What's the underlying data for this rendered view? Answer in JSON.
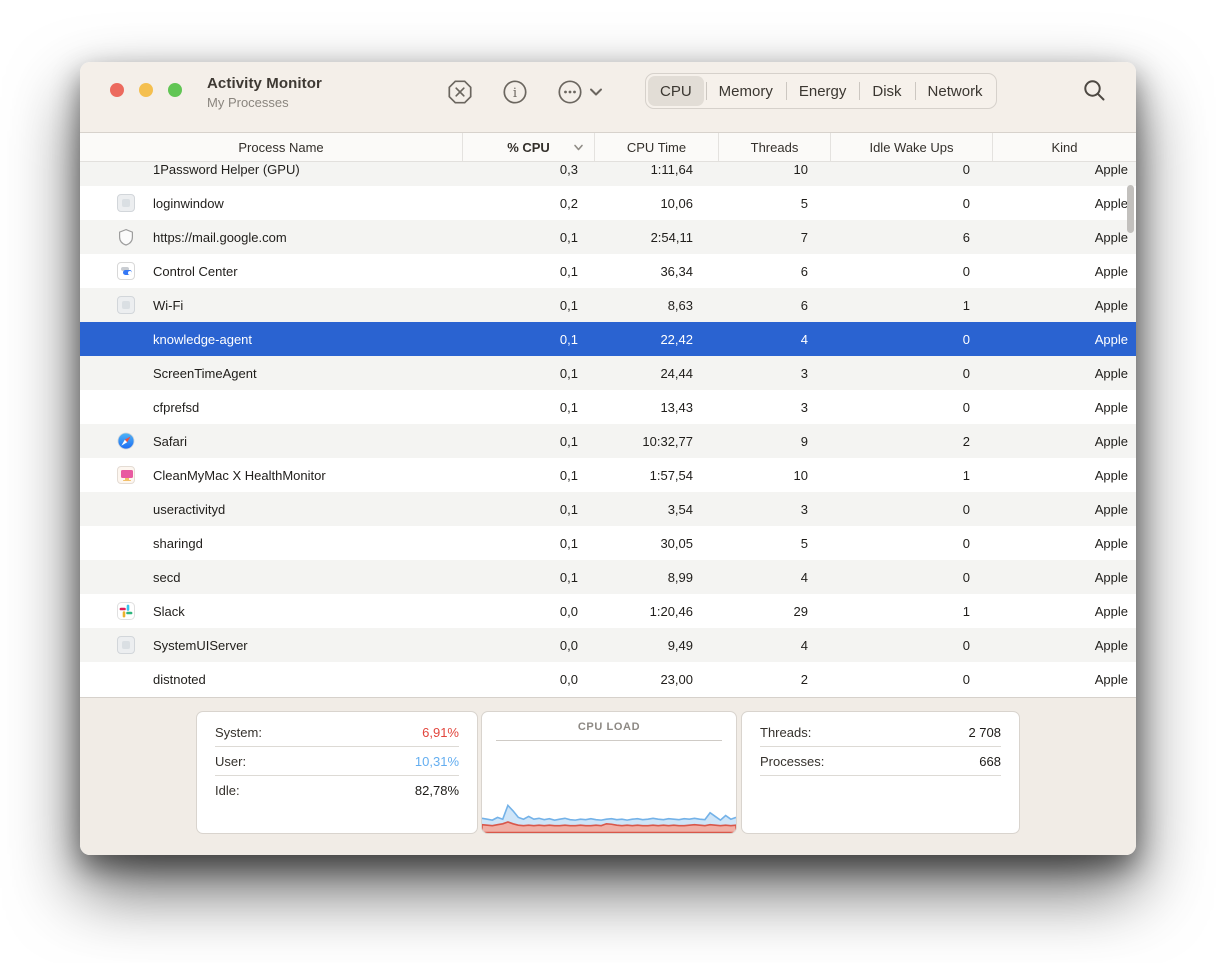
{
  "titlebar": {
    "title": "Activity Monitor",
    "subtitle": "My Processes",
    "segments": [
      {
        "label": "CPU",
        "selected": true
      },
      {
        "label": "Memory",
        "selected": false
      },
      {
        "label": "Energy",
        "selected": false
      },
      {
        "label": "Disk",
        "selected": false
      },
      {
        "label": "Network",
        "selected": false
      }
    ]
  },
  "table": {
    "columns": [
      {
        "label": "Process Name"
      },
      {
        "label": "% CPU",
        "sorted": "desc"
      },
      {
        "label": "CPU Time"
      },
      {
        "label": "Threads"
      },
      {
        "label": "Idle Wake Ups"
      },
      {
        "label": "Kind"
      }
    ],
    "rows": [
      {
        "name": "1Password Helper (GPU)",
        "icon": "none",
        "cpu": "0,3",
        "time": "1:11,64",
        "threads": "10",
        "wakeups": "0",
        "kind": "Apple",
        "clipped": true
      },
      {
        "name": "loginwindow",
        "icon": "generic-app",
        "cpu": "0,2",
        "time": "10,06",
        "threads": "5",
        "wakeups": "0",
        "kind": "Apple"
      },
      {
        "name": "https://mail.google.com",
        "icon": "shield",
        "cpu": "0,1",
        "time": "2:54,11",
        "threads": "7",
        "wakeups": "6",
        "kind": "Apple"
      },
      {
        "name": "Control Center",
        "icon": "control-center",
        "cpu": "0,1",
        "time": "36,34",
        "threads": "6",
        "wakeups": "0",
        "kind": "Apple"
      },
      {
        "name": "Wi-Fi",
        "icon": "generic-app",
        "cpu": "0,1",
        "time": "8,63",
        "threads": "6",
        "wakeups": "1",
        "kind": "Apple"
      },
      {
        "name": "knowledge-agent",
        "icon": "none",
        "cpu": "0,1",
        "time": "22,42",
        "threads": "4",
        "wakeups": "0",
        "kind": "Apple",
        "selected": true
      },
      {
        "name": "ScreenTimeAgent",
        "icon": "none",
        "cpu": "0,1",
        "time": "24,44",
        "threads": "3",
        "wakeups": "0",
        "kind": "Apple"
      },
      {
        "name": "cfprefsd",
        "icon": "none",
        "cpu": "0,1",
        "time": "13,43",
        "threads": "3",
        "wakeups": "0",
        "kind": "Apple"
      },
      {
        "name": "Safari",
        "icon": "safari",
        "cpu": "0,1",
        "time": "10:32,77",
        "threads": "9",
        "wakeups": "2",
        "kind": "Apple"
      },
      {
        "name": "CleanMyMac X HealthMonitor",
        "icon": "cleanmymac",
        "cpu": "0,1",
        "time": "1:57,54",
        "threads": "10",
        "wakeups": "1",
        "kind": "Apple"
      },
      {
        "name": "useractivityd",
        "icon": "none",
        "cpu": "0,1",
        "time": "3,54",
        "threads": "3",
        "wakeups": "0",
        "kind": "Apple"
      },
      {
        "name": "sharingd",
        "icon": "none",
        "cpu": "0,1",
        "time": "30,05",
        "threads": "5",
        "wakeups": "0",
        "kind": "Apple"
      },
      {
        "name": "secd",
        "icon": "none",
        "cpu": "0,1",
        "time": "8,99",
        "threads": "4",
        "wakeups": "0",
        "kind": "Apple"
      },
      {
        "name": "Slack",
        "icon": "slack",
        "cpu": "0,0",
        "time": "1:20,46",
        "threads": "29",
        "wakeups": "1",
        "kind": "Apple"
      },
      {
        "name": "SystemUIServer",
        "icon": "generic-app",
        "cpu": "0,0",
        "time": "9,49",
        "threads": "4",
        "wakeups": "0",
        "kind": "Apple"
      },
      {
        "name": "distnoted",
        "icon": "none",
        "cpu": "0,0",
        "time": "23,00",
        "threads": "2",
        "wakeups": "0",
        "kind": "Apple"
      }
    ]
  },
  "footer": {
    "cpu_summary": {
      "system_label": "System:",
      "system_value": "6,91%",
      "user_label": "User:",
      "user_value": "10,31%",
      "idle_label": "Idle:",
      "idle_value": "82,78%"
    },
    "load_panel": {
      "title": "CPU LOAD"
    },
    "counts": {
      "threads_label": "Threads:",
      "threads_value": "2 708",
      "processes_label": "Processes:",
      "processes_value": "668"
    }
  },
  "colors": {
    "selection_blue": "#2a63d1",
    "system_red": "#e2453c",
    "user_blue": "#64aef0",
    "graph_blue_line": "#74b2e8",
    "graph_blue_fill": "#cfe5f8",
    "graph_red_line": "#d9574a",
    "graph_red_fill": "#f0b0a6"
  },
  "cpu_load_graph": {
    "type": "area",
    "unit": "percent_of_panel_height",
    "series": [
      {
        "name": "user",
        "color": "blue",
        "values": [
          32,
          30,
          28,
          34,
          30,
          60,
          48,
          34,
          30,
          36,
          30,
          32,
          29,
          31,
          28,
          30,
          32,
          29,
          28,
          30,
          29,
          31,
          29,
          28,
          30,
          31,
          29,
          30,
          28,
          30,
          31,
          29,
          30,
          32,
          30,
          29,
          31,
          30,
          29,
          31,
          30,
          32,
          30,
          29,
          44,
          36,
          28,
          38,
          30,
          34
        ]
      },
      {
        "name": "system",
        "color": "red",
        "values": [
          18,
          17,
          16,
          18,
          20,
          24,
          20,
          17,
          16,
          17,
          16,
          17,
          16,
          17,
          16,
          16,
          17,
          16,
          16,
          17,
          16,
          16,
          17,
          16,
          20,
          19,
          17,
          16,
          17,
          16,
          17,
          16,
          16,
          17,
          16,
          17,
          16,
          17,
          16,
          16,
          17,
          18,
          17,
          16,
          18,
          17,
          16,
          17,
          16,
          17
        ]
      }
    ]
  }
}
